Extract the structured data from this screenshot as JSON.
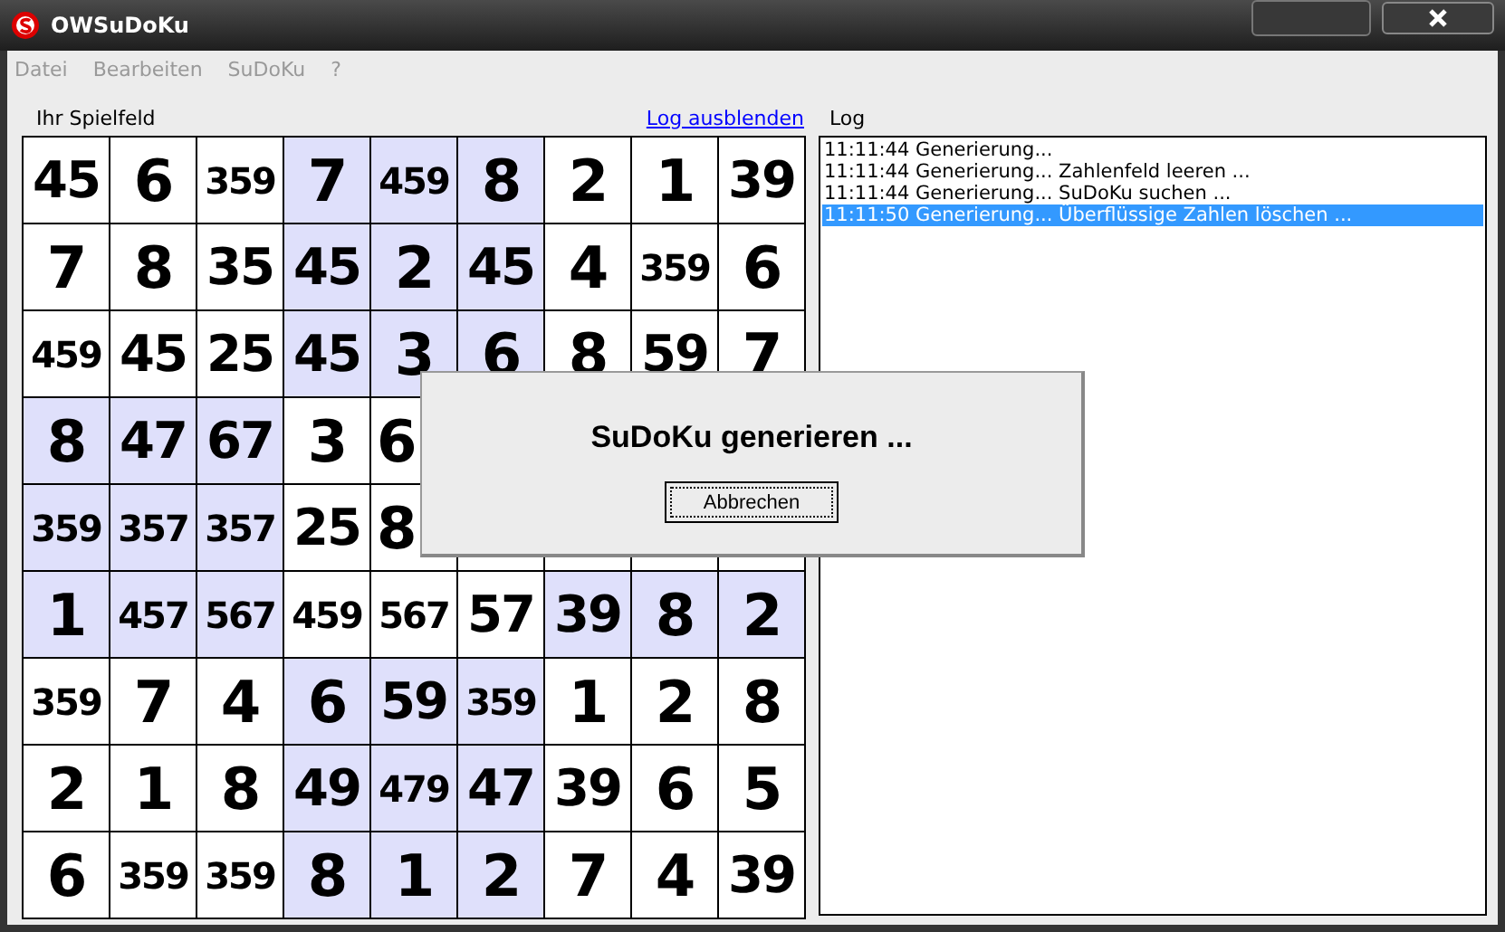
{
  "window": {
    "title": "OWSuDoKu"
  },
  "menu": [
    "Datei",
    "Bearbeiten",
    "SuDoKu",
    "?"
  ],
  "board": {
    "label": "Ihr Spielfeld",
    "toggle_link": "Log ausblenden",
    "rows": [
      [
        {
          "value": "45",
          "highlighted": false
        },
        {
          "value": "6",
          "highlighted": false
        },
        {
          "value": "359",
          "highlighted": false
        },
        {
          "value": "7",
          "highlighted": true
        },
        {
          "value": "459",
          "highlighted": true
        },
        {
          "value": "8",
          "highlighted": true
        },
        {
          "value": "2",
          "highlighted": false
        },
        {
          "value": "1",
          "highlighted": false
        },
        {
          "value": "39",
          "highlighted": false
        }
      ],
      [
        {
          "value": "7",
          "highlighted": false
        },
        {
          "value": "8",
          "highlighted": false
        },
        {
          "value": "35",
          "highlighted": false
        },
        {
          "value": "45",
          "highlighted": true
        },
        {
          "value": "2",
          "highlighted": true
        },
        {
          "value": "45",
          "highlighted": true
        },
        {
          "value": "4",
          "highlighted": false
        },
        {
          "value": "359",
          "highlighted": false
        },
        {
          "value": "6",
          "highlighted": false
        }
      ],
      [
        {
          "value": "459",
          "highlighted": false
        },
        {
          "value": "45",
          "highlighted": false
        },
        {
          "value": "25",
          "highlighted": false
        },
        {
          "value": "45",
          "highlighted": true
        },
        {
          "value": "3",
          "highlighted": true
        },
        {
          "value": "6",
          "highlighted": true
        },
        {
          "value": "8",
          "highlighted": false
        },
        {
          "value": "59",
          "highlighted": false
        },
        {
          "value": "7",
          "highlighted": false
        }
      ],
      [
        {
          "value": "8",
          "highlighted": true
        },
        {
          "value": "47",
          "highlighted": true
        },
        {
          "value": "67",
          "highlighted": true
        },
        {
          "value": "3",
          "highlighted": false
        },
        {
          "value": "6",
          "highlighted": false
        },
        null,
        null,
        null,
        null
      ],
      [
        {
          "value": "359",
          "highlighted": true
        },
        {
          "value": "357",
          "highlighted": true
        },
        {
          "value": "357",
          "highlighted": true
        },
        {
          "value": "25",
          "highlighted": false
        },
        {
          "value": "8",
          "highlighted": false
        },
        null,
        null,
        null,
        null
      ],
      [
        {
          "value": "1",
          "highlighted": true
        },
        {
          "value": "457",
          "highlighted": true
        },
        {
          "value": "567",
          "highlighted": true
        },
        {
          "value": "459",
          "highlighted": false
        },
        {
          "value": "567",
          "highlighted": false
        },
        {
          "value": "57",
          "highlighted": false
        },
        {
          "value": "39",
          "highlighted": true
        },
        {
          "value": "8",
          "highlighted": true
        },
        {
          "value": "2",
          "highlighted": true
        }
      ],
      [
        {
          "value": "359",
          "highlighted": false
        },
        {
          "value": "7",
          "highlighted": false
        },
        {
          "value": "4",
          "highlighted": false
        },
        {
          "value": "6",
          "highlighted": true
        },
        {
          "value": "59",
          "highlighted": true
        },
        {
          "value": "359",
          "highlighted": true
        },
        {
          "value": "1",
          "highlighted": false
        },
        {
          "value": "2",
          "highlighted": false
        },
        {
          "value": "8",
          "highlighted": false
        }
      ],
      [
        {
          "value": "2",
          "highlighted": false
        },
        {
          "value": "1",
          "highlighted": false
        },
        {
          "value": "8",
          "highlighted": false
        },
        {
          "value": "49",
          "highlighted": true
        },
        {
          "value": "479",
          "highlighted": true
        },
        {
          "value": "47",
          "highlighted": true
        },
        {
          "value": "39",
          "highlighted": false
        },
        {
          "value": "6",
          "highlighted": false
        },
        {
          "value": "5",
          "highlighted": false
        }
      ],
      [
        {
          "value": "6",
          "highlighted": false
        },
        {
          "value": "359",
          "highlighted": false
        },
        {
          "value": "359",
          "highlighted": false
        },
        {
          "value": "8",
          "highlighted": true
        },
        {
          "value": "1",
          "highlighted": true
        },
        {
          "value": "2",
          "highlighted": true
        },
        {
          "value": "7",
          "highlighted": false
        },
        {
          "value": "4",
          "highlighted": false
        },
        {
          "value": "39",
          "highlighted": false
        }
      ]
    ]
  },
  "log": {
    "label": "Log",
    "entries": [
      {
        "text": "11:11:44 Generierung...",
        "selected": false
      },
      {
        "text": "11:11:44 Generierung... Zahlenfeld leeren ...",
        "selected": false
      },
      {
        "text": "11:11:44 Generierung... SuDoKu suchen ...",
        "selected": false
      },
      {
        "text": "11:11:50 Generierung... Überflüssige Zahlen löschen ...",
        "selected": true
      }
    ]
  },
  "dialog": {
    "message": "SuDoKu generieren ...",
    "button": "Abbrechen"
  }
}
